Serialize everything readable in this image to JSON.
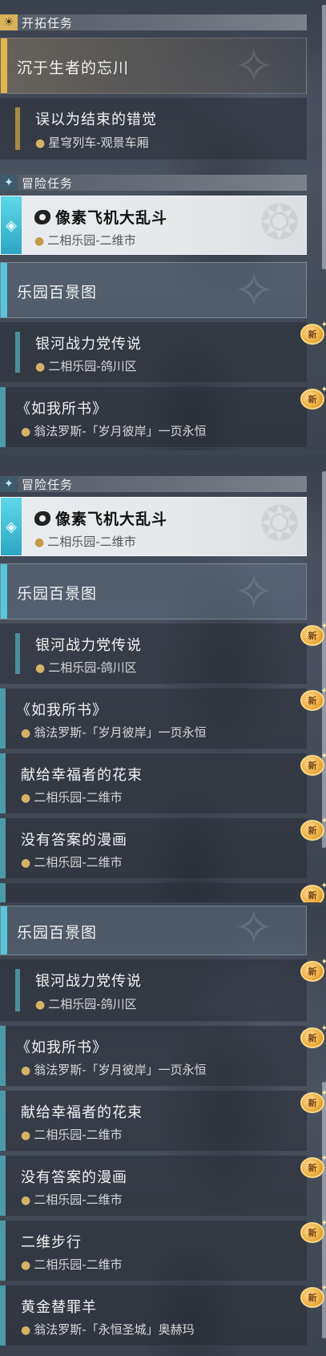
{
  "sections": {
    "trailblaze": {
      "title": "开拓任务",
      "icon": "sun-gear-icon"
    },
    "adventure": {
      "title": "冒险任务",
      "icon": "sparkle-diamond-icon"
    }
  },
  "quests": {
    "chenyu": {
      "title": "沉于生者的忘川"
    },
    "wuyi": {
      "title": "误以为结束的错觉",
      "location": "星穹列车-观景车厢"
    },
    "pixel": {
      "title": "像素飞机大乱斗",
      "location": "二相乐园-二维市"
    },
    "leyuan": {
      "title": "乐园百景图"
    },
    "yinhe": {
      "title": "银河战力党传说",
      "location": "二相乐园-鸽川区"
    },
    "ruwo": {
      "title": "《如我所书》",
      "location": "翁法罗斯-「岁月彼岸」一页永恒"
    },
    "xiangei": {
      "title": "献给幸福者的花束",
      "location": "二相乐园-二维市"
    },
    "meiyou": {
      "title": "没有答案的漫画",
      "location": "二相乐园-二维市"
    },
    "erwei": {
      "title": "二维步行",
      "location": "二相乐园-二维市"
    },
    "huangjin": {
      "title": "黄金替罪羊",
      "location": "翁法罗斯-「永恒圣城」奥赫玛"
    }
  },
  "badge": {
    "new_label": "新"
  },
  "icons": {
    "pin": "map-pin-icon",
    "game": "game-controller-icon",
    "diamond": "diamond-icon"
  },
  "colors": {
    "gold_accent": "#e0b64c",
    "teal_accent": "#56c6d8",
    "badge": "#e7a12c"
  }
}
